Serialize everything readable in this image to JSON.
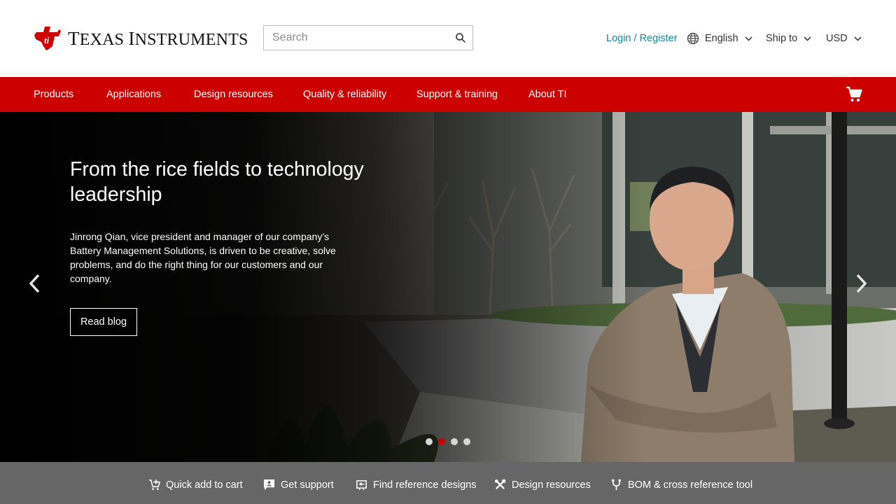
{
  "brand": {
    "name": "Texas Instruments",
    "name_parts": [
      "T",
      "EXAS ",
      "I",
      "NSTRUMENTS"
    ],
    "logo_icon": "ti-bug-logo",
    "brand_color": "#cc0000"
  },
  "search": {
    "placeholder": "Search",
    "icon": "search-icon"
  },
  "utility": {
    "login": "Login / Register",
    "language": "English",
    "ship_to": "Ship to",
    "currency": "USD",
    "link_color": "#118899"
  },
  "nav": {
    "items": [
      "Products",
      "Applications",
      "Design resources",
      "Quality & reliability",
      "Support & training",
      "About TI"
    ],
    "cart_icon": "cart-icon"
  },
  "hero": {
    "title": "From the rice fields to technology leadership",
    "body": "Jinrong Qian, vice president and manager of our company’s Battery Management Solutions, is driven to be creative, solve problems, and do the right thing for our customers and our company.",
    "button": "Read blog",
    "slides_total": 4,
    "active_slide": 2
  },
  "quick_links": [
    {
      "label": "Quick add to cart",
      "icon": "cart-add-icon"
    },
    {
      "label": "Get support",
      "icon": "support-chat-icon"
    },
    {
      "label": "Find reference designs",
      "icon": "reference-design-icon"
    },
    {
      "label": "Design resources",
      "icon": "tools-icon"
    },
    {
      "label": "BOM & cross reference tool",
      "icon": "bom-branch-icon"
    }
  ],
  "colors": {
    "nav_bg": "#cc0000",
    "bottom_bar_bg": "#666666"
  }
}
